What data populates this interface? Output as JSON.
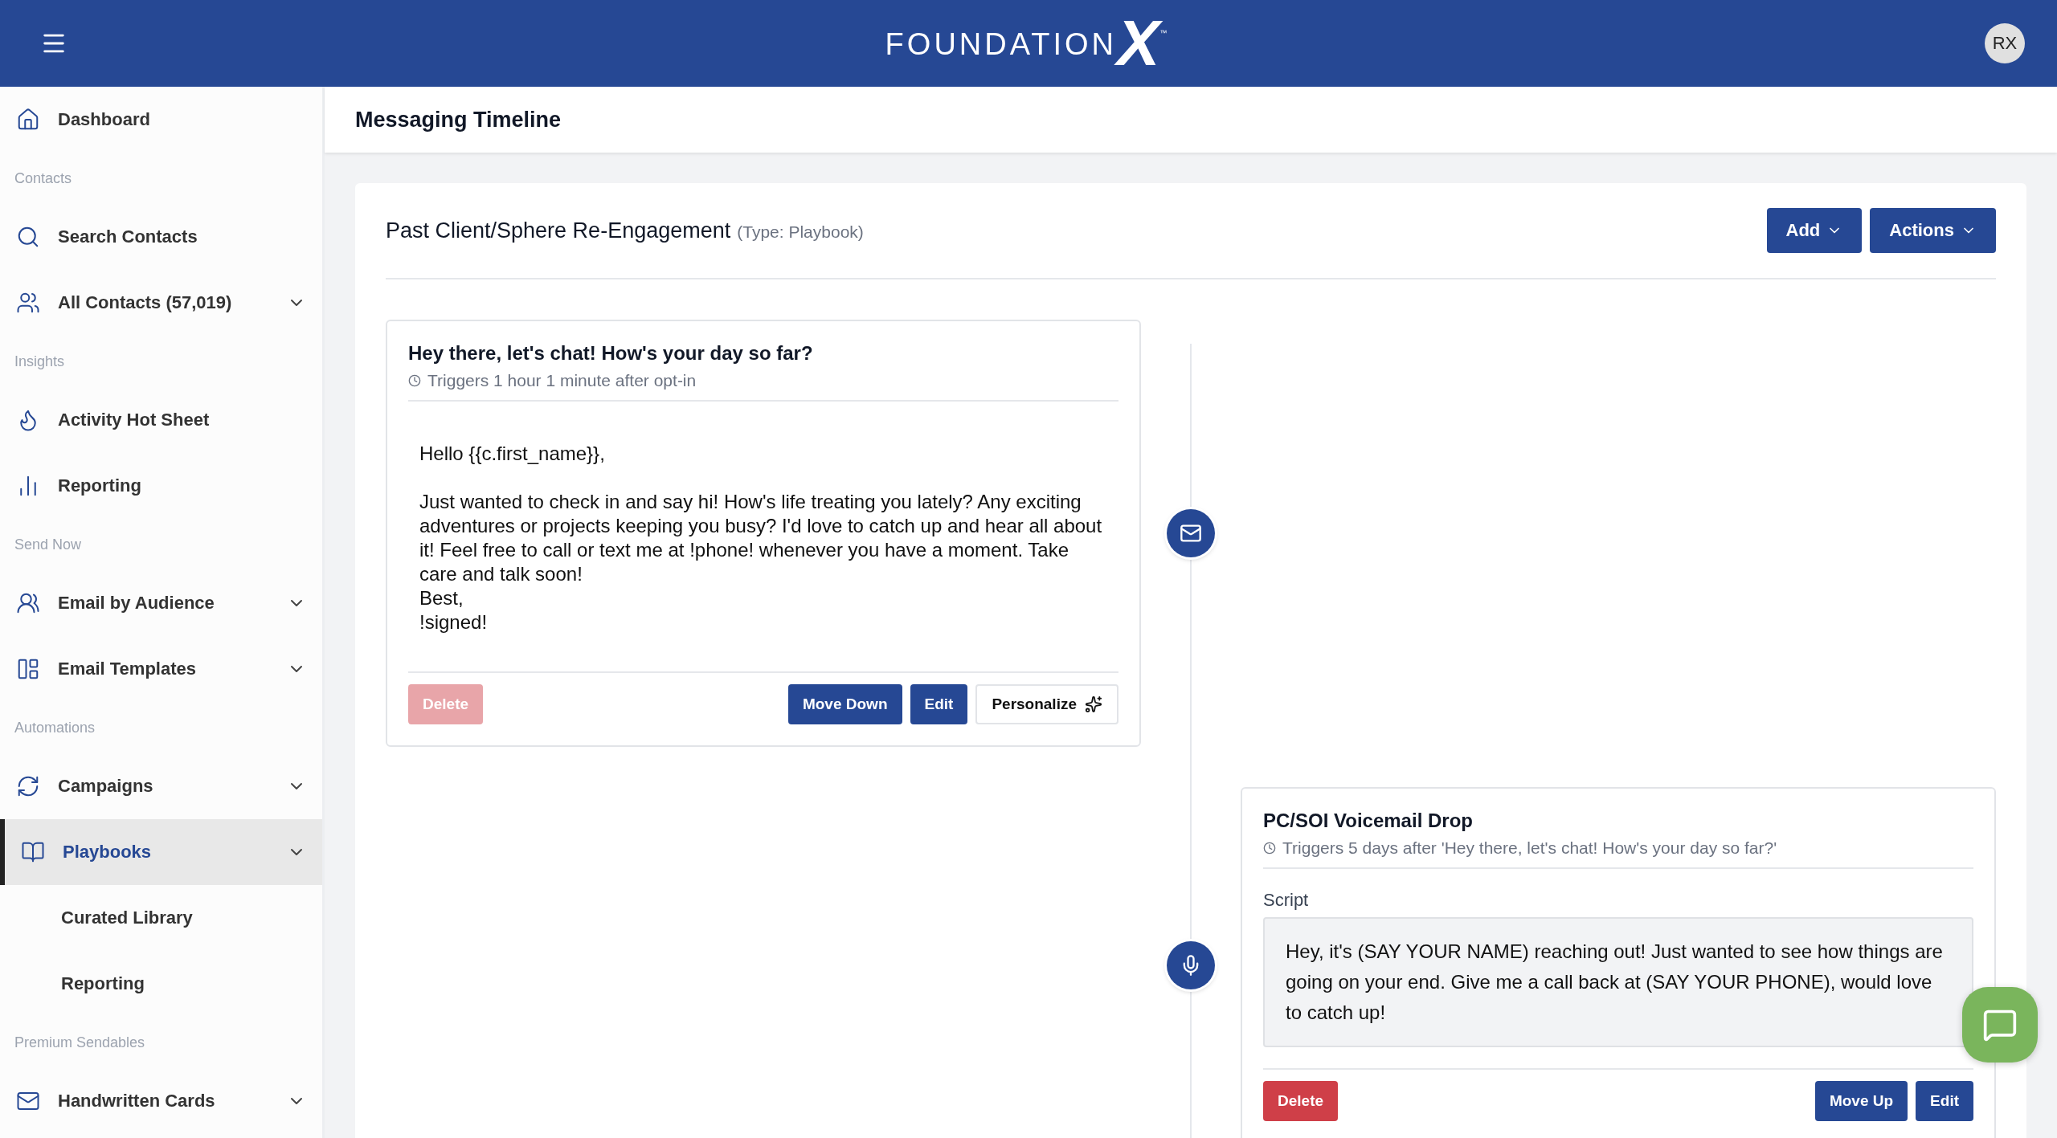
{
  "header": {
    "logo": {
      "word": "FOUNDATION",
      "mark": "X",
      "tm": "™"
    },
    "avatar": "RX"
  },
  "sidebar": {
    "items": [
      {
        "kind": "item",
        "label": "Dashboard",
        "expandable": false,
        "selected": false
      },
      {
        "kind": "section",
        "label": "Contacts"
      },
      {
        "kind": "item",
        "label": "Search Contacts",
        "expandable": false,
        "selected": false
      },
      {
        "kind": "item",
        "label": "All Contacts (57,019)",
        "expandable": true,
        "selected": false
      },
      {
        "kind": "section",
        "label": "Insights"
      },
      {
        "kind": "item",
        "label": "Activity Hot Sheet",
        "expandable": false,
        "selected": false
      },
      {
        "kind": "item",
        "label": "Reporting",
        "expandable": false,
        "selected": false
      },
      {
        "kind": "section",
        "label": "Send Now"
      },
      {
        "kind": "item",
        "label": "Email by Audience",
        "expandable": true,
        "selected": false
      },
      {
        "kind": "item",
        "label": "Email Templates",
        "expandable": true,
        "selected": false
      },
      {
        "kind": "section",
        "label": "Automations"
      },
      {
        "kind": "item",
        "label": "Campaigns",
        "expandable": true,
        "selected": false
      },
      {
        "kind": "item",
        "label": "Playbooks",
        "expandable": true,
        "selected": true
      },
      {
        "kind": "subitem",
        "label": "Curated Library",
        "selected": false
      },
      {
        "kind": "subitem",
        "label": "Reporting",
        "selected": false
      },
      {
        "kind": "section",
        "label": "Premium Sendables"
      },
      {
        "kind": "item",
        "label": "Handwritten Cards",
        "expandable": true,
        "selected": false
      }
    ]
  },
  "page": {
    "title": "Messaging Timeline"
  },
  "panel": {
    "title": "Past Client/Sphere Re-Engagement",
    "type_note": "(Type: Playbook)",
    "buttons": [
      "Add",
      "Actions"
    ]
  },
  "steps": [
    {
      "kind": "email",
      "title": "Hey there, let's chat! How's your day so far?",
      "trigger": "Triggers 1 hour 1 minute after opt-in",
      "body": "Hello {{c.first_name}},\n\nJust wanted to check in and say hi! How's life treating you lately? Any exciting adventures or projects keeping you busy? I'd love to catch up and hear all about it! Feel free to call or text me at !phone! whenever you have a moment. Take care and talk soon!\nBest,\n!signed!",
      "buttons": [
        {
          "label": "Delete",
          "kind": "delete",
          "disabled": true
        },
        {
          "label": "Move Down",
          "kind": "primary",
          "disabled": false
        },
        {
          "label": "Edit",
          "kind": "primary",
          "disabled": false
        },
        {
          "label": "Personalize",
          "kind": "outline",
          "disabled": false
        }
      ]
    },
    {
      "kind": "voicemail",
      "title": "PC/SOI Voicemail Drop",
      "trigger": "Triggers 5 days after 'Hey there, let's chat! How's your day so far?'",
      "script_label": "Script",
      "script": "Hey, it's (SAY YOUR NAME) reaching out! Just wanted to see how things are going on your end. Give me a call back at (SAY YOUR PHONE), would love to catch up!",
      "buttons": [
        {
          "label": "Delete",
          "kind": "delete",
          "disabled": false
        },
        {
          "label": "Move Up",
          "kind": "primary",
          "disabled": false
        },
        {
          "label": "Edit",
          "kind": "primary",
          "disabled": false
        }
      ]
    }
  ]
}
